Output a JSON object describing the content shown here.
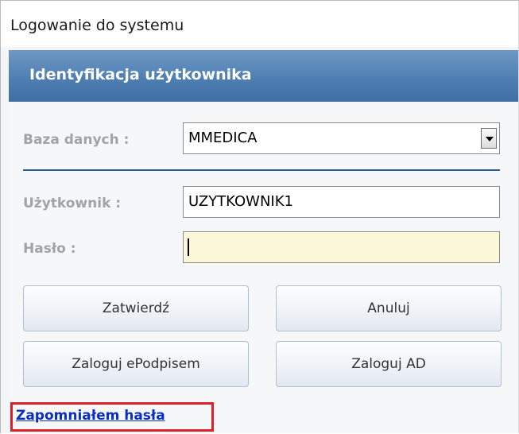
{
  "window": {
    "title": "Logowanie do systemu"
  },
  "header": {
    "title": "Identyfikacja użytkownika"
  },
  "form": {
    "database_label": "Baza danych :",
    "database_value": "MMEDICA",
    "user_label": "Użytkownik :",
    "user_value": "UZYTKOWNIK1",
    "password_label": "Hasło :",
    "password_value": ""
  },
  "buttons": {
    "confirm": "Zatwierdź",
    "cancel": "Anuluj",
    "login_esignature": "Zaloguj ePodpisem",
    "login_ad": "Zaloguj AD"
  },
  "links": {
    "forgot_password": "Zapomniałem hasła"
  },
  "colors": {
    "header_accent": "#4f7fb2",
    "highlight_box": "#dd1f2a",
    "link": "#0a2fbf",
    "password_bg": "#fbf7d8"
  }
}
